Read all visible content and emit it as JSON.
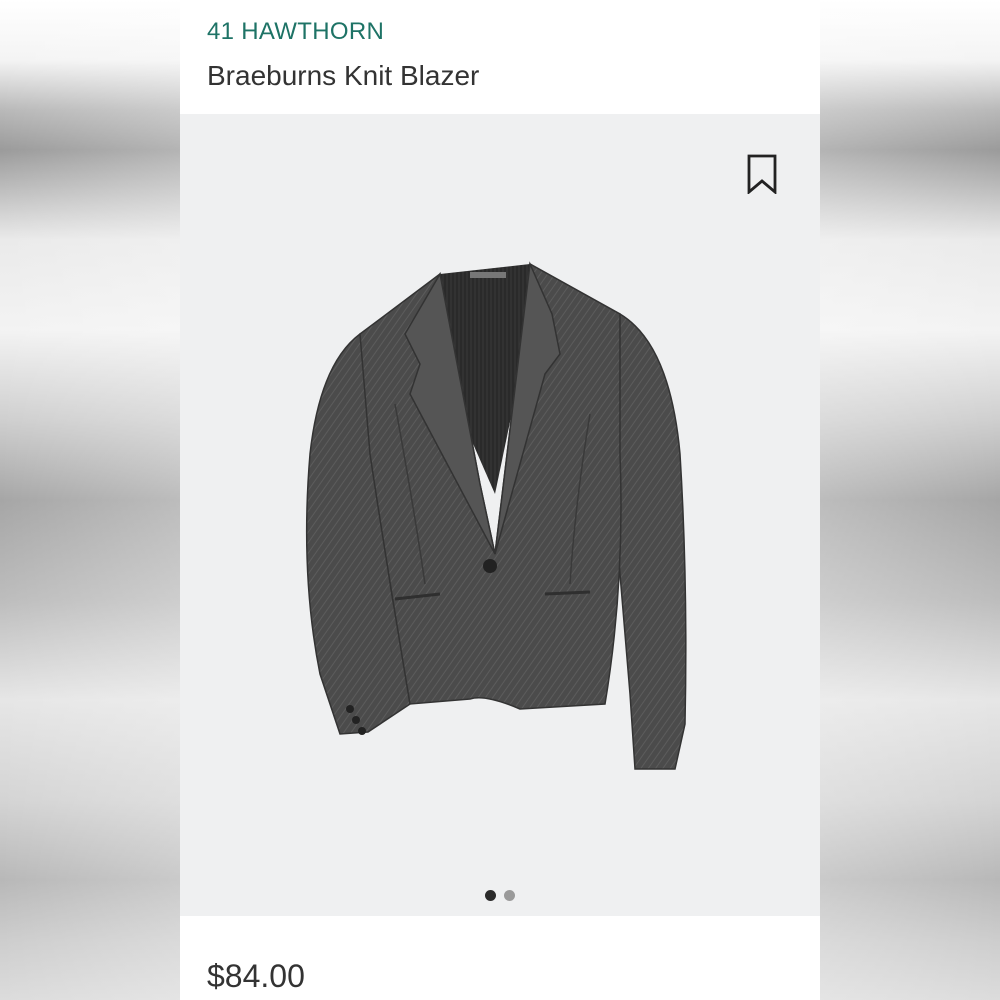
{
  "product": {
    "brand": "41 HAWTHORN",
    "name": "Braeburns Knit Blazer",
    "price": "$84.00"
  },
  "image": {
    "icon": "bookmark-icon",
    "carousel": {
      "total": 2,
      "active": 1
    }
  },
  "colors": {
    "brand": "#1e7366",
    "text": "#333333",
    "image_bg": "#eff0f1",
    "jacket": "#4a4a4a"
  }
}
